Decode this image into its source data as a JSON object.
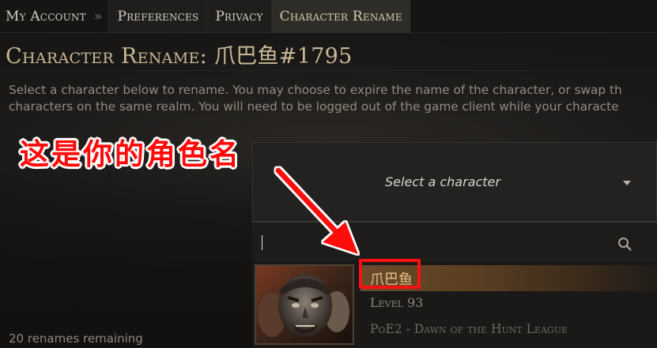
{
  "nav": {
    "home": "My Account",
    "separator": "»",
    "tabs": [
      {
        "label": "Preferences",
        "active": false
      },
      {
        "label": "Privacy",
        "active": false
      },
      {
        "label": "Character Rename",
        "active": true
      }
    ]
  },
  "page": {
    "title": "Character Rename: 爪巴鱼#1795",
    "description_lines": [
      "Select a character below to rename. You may choose to expire the name of the character, or swap th",
      "characters on the same realm. You will need to be logged out of the game client while your characte"
    ],
    "renames_remaining": "20 renames remaining"
  },
  "annotation": {
    "text": "这是你的角色名",
    "color": "#ff0a0a"
  },
  "dropdown": {
    "placeholder": "Select a character",
    "search_value": "",
    "selected_character": {
      "name": "爪巴鱼",
      "level": "Level 93",
      "league": "PoE2 - Dawn of the Hunt League"
    }
  },
  "icons": {
    "search": "search-icon",
    "caret": "chevron-down-icon"
  },
  "colors": {
    "accent_gold": "#c9b896",
    "highlight": "#6a4a2a",
    "annotation_red": "#ff1010"
  }
}
